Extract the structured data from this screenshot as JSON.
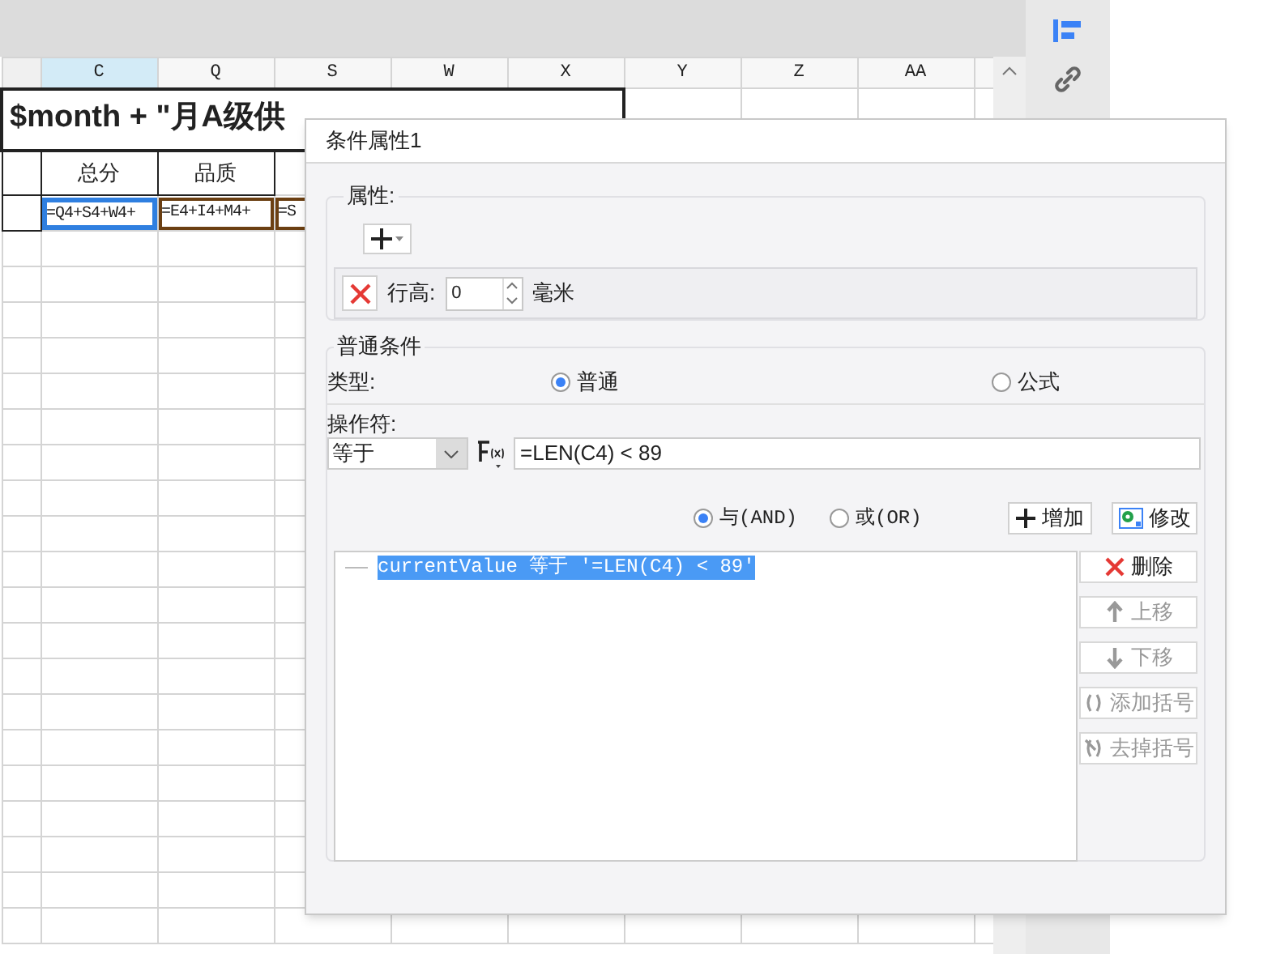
{
  "sheet": {
    "columns": [
      {
        "label": "C",
        "selected": true
      },
      {
        "label": "Q",
        "selected": false
      },
      {
        "label": "S",
        "selected": false
      },
      {
        "label": "W",
        "selected": false
      },
      {
        "label": "X",
        "selected": false
      },
      {
        "label": "Y",
        "selected": false
      },
      {
        "label": "Z",
        "selected": false
      },
      {
        "label": "AA",
        "selected": false
      }
    ],
    "title": "$month + \"月A级供",
    "header_cells": [
      "总分",
      "品质"
    ],
    "formula_cells": [
      {
        "text": "=Q4+S4+W4+",
        "selected": true
      },
      {
        "text": "=E4+I4+M4+",
        "selected": false
      },
      {
        "text": "=S",
        "selected": false
      }
    ]
  },
  "dialog": {
    "title": "条件属性1",
    "attributes": {
      "legend": "属性:",
      "row_height_label": "行高:",
      "row_height_value": "0",
      "unit": "毫米"
    },
    "condition": {
      "legend": "普通条件",
      "type_label": "类型:",
      "types": [
        {
          "label": "普通",
          "selected": true
        },
        {
          "label": "公式",
          "selected": false
        }
      ],
      "operator_label": "操作符:",
      "operator": "等于",
      "value": "=LEN(C4) < 89",
      "logic": [
        {
          "label": "与(AND)",
          "selected": true
        },
        {
          "label": "或(OR)",
          "selected": false
        }
      ],
      "add_button": "增加",
      "modify_button": "修改",
      "conditions": [
        {
          "text": "currentValue 等于 '=LEN(C4) < 89'",
          "selected": true
        }
      ],
      "side_buttons": [
        {
          "kind": "delete",
          "label": "删除",
          "disabled": false
        },
        {
          "kind": "up",
          "label": "上移",
          "disabled": true
        },
        {
          "kind": "down",
          "label": "下移",
          "disabled": true
        },
        {
          "kind": "add-paren",
          "label": "添加括号",
          "disabled": true
        },
        {
          "kind": "remove-paren",
          "label": "去掉括号",
          "disabled": true
        }
      ]
    }
  }
}
